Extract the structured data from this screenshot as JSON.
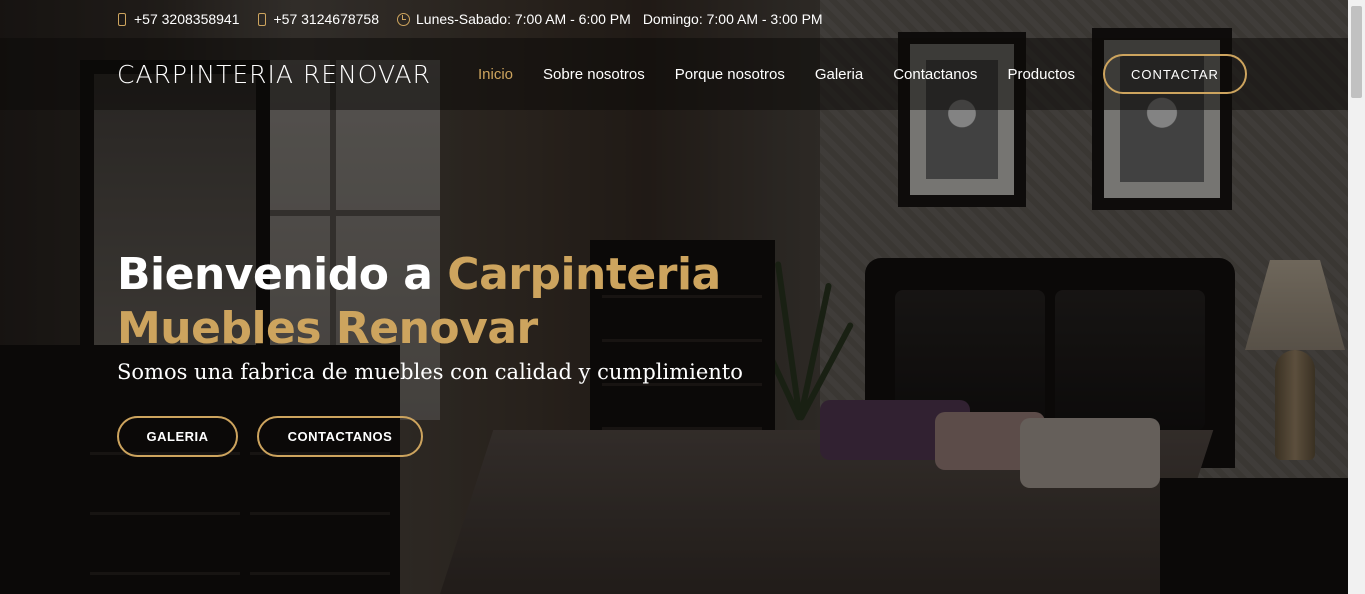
{
  "topbar": {
    "phone1": "+57 3208358941",
    "phone2": "+57 3124678758",
    "hours1": "Lunes-Sabado: 7:00 AM - 6:00 PM",
    "hours2": "Domingo: 7:00 AM - 3:00 PM",
    "icons": [
      "phone-icon",
      "phone-icon",
      "clock-icon"
    ]
  },
  "header": {
    "logo": "CARPINTERIA RENOVAR",
    "nav": [
      {
        "label": "Inicio",
        "active": true
      },
      {
        "label": "Sobre nosotros"
      },
      {
        "label": "Porque nosotros"
      },
      {
        "label": "Galeria"
      },
      {
        "label": "Contactanos"
      },
      {
        "label": "Productos"
      }
    ],
    "cta": "CONTACTAR"
  },
  "hero": {
    "title_white": "Bienvenido a",
    "title_gold": "Carpinteria Muebles Renovar",
    "subtitle": "Somos una fabrica de muebles con calidad y cumplimiento",
    "btn_galeria": "GALERIA",
    "btn_contactanos": "CONTACTANOS"
  },
  "colors": {
    "accent": "#cda45e",
    "text": "#ffffff"
  }
}
